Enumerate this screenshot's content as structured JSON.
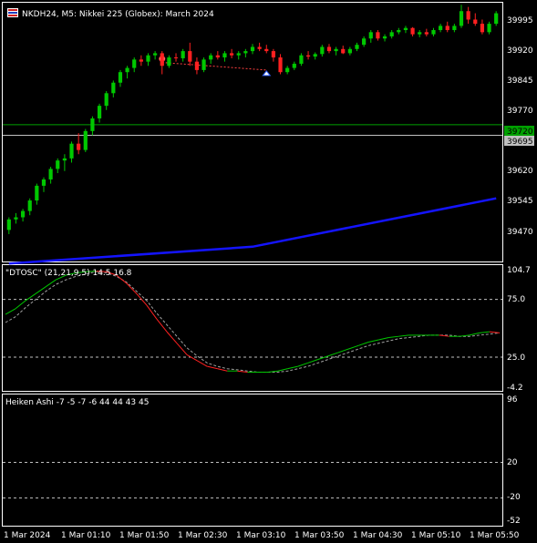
{
  "main_title": "NKDH24, M5:  Nikkei 225 (Globex): March 2024",
  "main_axis_labels": [
    "39995",
    "39920",
    "39845",
    "39770",
    "39620",
    "39545",
    "39470"
  ],
  "level_labels": [
    "39720",
    "39695"
  ],
  "osc_title": "\"DTOSC\" (21,21,9,5) 14.5 16.8",
  "osc_axis_labels": [
    "104.7",
    "75.0",
    "25.0",
    "-4.2"
  ],
  "ha_title": "Heiken Ashi -7 -5 -7 -6 44 44 43 45",
  "ha_axis_labels": [
    "96",
    "20",
    "-20",
    "-52"
  ],
  "time_labels": [
    "1 Mar 2024",
    "1 Mar 01:10",
    "1 Mar 01:50",
    "1 Mar 02:30",
    "1 Mar 03:10",
    "1 Mar 03:50",
    "1 Mar 04:30",
    "1 Mar 05:10",
    "1 Mar 05:50"
  ],
  "colors": {
    "background": "#000000",
    "bull": "#00c800",
    "bear": "#ff2020",
    "ma": "#1414ff",
    "level": "#00a000",
    "grid": "#c0c0c0"
  },
  "chart_data": {
    "type": "candlestick",
    "candles": [
      [
        39470,
        39500,
        39460,
        39495
      ],
      [
        39495,
        39510,
        39485,
        39500
      ],
      [
        39500,
        39520,
        39490,
        39515
      ],
      [
        39515,
        39545,
        39505,
        39540
      ],
      [
        39540,
        39580,
        39530,
        39575
      ],
      [
        39575,
        39595,
        39560,
        39590
      ],
      [
        39590,
        39620,
        39580,
        39615
      ],
      [
        39615,
        39640,
        39605,
        39635
      ],
      [
        39635,
        39650,
        39610,
        39640
      ],
      [
        39640,
        39680,
        39630,
        39675
      ],
      [
        39675,
        39700,
        39650,
        39660
      ],
      [
        39660,
        39710,
        39655,
        39705
      ],
      [
        39705,
        39740,
        39695,
        39735
      ],
      [
        39735,
        39770,
        39725,
        39765
      ],
      [
        39765,
        39800,
        39755,
        39795
      ],
      [
        39795,
        39825,
        39785,
        39820
      ],
      [
        39820,
        39850,
        39810,
        39845
      ],
      [
        39845,
        39860,
        39830,
        39855
      ],
      [
        39855,
        39880,
        39845,
        39875
      ],
      [
        39875,
        39885,
        39860,
        39870
      ],
      [
        39870,
        39890,
        39860,
        39885
      ],
      [
        39885,
        39895,
        39875,
        39890
      ],
      [
        39890,
        39895,
        39840,
        39860
      ],
      [
        39860,
        39885,
        39855,
        39880
      ],
      [
        39880,
        39890,
        39870,
        39878
      ],
      [
        39878,
        39900,
        39870,
        39895
      ],
      [
        39895,
        39915,
        39860,
        39870
      ],
      [
        39870,
        39880,
        39840,
        39850
      ],
      [
        39850,
        39880,
        39845,
        39875
      ],
      [
        39875,
        39890,
        39865,
        39885
      ],
      [
        39885,
        39895,
        39875,
        39880
      ],
      [
        39880,
        39895,
        39870,
        39890
      ],
      [
        39890,
        39900,
        39878,
        39885
      ],
      [
        39885,
        39895,
        39875,
        39890
      ],
      [
        39890,
        39900,
        39880,
        39895
      ],
      [
        39895,
        39912,
        39888,
        39905
      ],
      [
        39905,
        39915,
        39895,
        39900
      ],
      [
        39900,
        39910,
        39890,
        39895
      ],
      [
        39895,
        39900,
        39870,
        39880
      ],
      [
        39880,
        39888,
        39840,
        39845
      ],
      [
        39845,
        39860,
        39840,
        39855
      ],
      [
        39855,
        39870,
        39850,
        39865
      ],
      [
        39865,
        39890,
        39860,
        39885
      ],
      [
        39885,
        39895,
        39875,
        39882
      ],
      [
        39882,
        39892,
        39875,
        39888
      ],
      [
        39888,
        39910,
        39882,
        39905
      ],
      [
        39905,
        39912,
        39890,
        39895
      ],
      [
        39895,
        39905,
        39885,
        39900
      ],
      [
        39900,
        39908,
        39888,
        39890
      ],
      [
        39890,
        39905,
        39885,
        39900
      ],
      [
        39900,
        39915,
        39895,
        39910
      ],
      [
        39910,
        39930,
        39905,
        39925
      ],
      [
        39925,
        39945,
        39915,
        39940
      ],
      [
        39940,
        39945,
        39920,
        39925
      ],
      [
        39925,
        39935,
        39918,
        39930
      ],
      [
        39930,
        39945,
        39925,
        39940
      ],
      [
        39940,
        39950,
        39935,
        39945
      ],
      [
        39945,
        39955,
        39938,
        39950
      ],
      [
        39950,
        39952,
        39930,
        39935
      ],
      [
        39935,
        39945,
        39928,
        39940
      ],
      [
        39940,
        39948,
        39930,
        39935
      ],
      [
        39935,
        39950,
        39930,
        39945
      ],
      [
        39945,
        39960,
        39940,
        39955
      ],
      [
        39955,
        39965,
        39940,
        39945
      ],
      [
        39945,
        39960,
        39940,
        39955
      ],
      [
        39955,
        40005,
        39950,
        39990
      ],
      [
        39990,
        40000,
        39960,
        39970
      ],
      [
        39970,
        39985,
        39955,
        39960
      ],
      [
        39960,
        39970,
        39935,
        39940
      ],
      [
        39940,
        39965,
        39935,
        39960
      ],
      [
        39960,
        39990,
        39955,
        39985
      ]
    ],
    "ma_line": [
      [
        0,
        39390
      ],
      [
        35,
        39430
      ],
      [
        70,
        39545
      ]
    ],
    "arrow_line": [
      [
        22,
        39868
      ],
      [
        37,
        39850
      ]
    ],
    "levels": [
      39720,
      39695
    ],
    "osc": {
      "main": [
        62,
        67,
        74,
        80,
        86,
        92,
        96,
        98,
        99,
        99.5,
        99,
        96,
        89,
        80,
        70,
        58,
        47,
        37,
        27,
        22,
        17,
        15,
        13,
        13,
        12,
        12,
        12,
        13,
        15,
        17,
        20,
        23,
        26,
        29,
        32,
        35,
        38,
        40,
        42,
        43,
        44,
        44,
        44,
        44,
        43,
        43,
        44,
        46,
        47,
        46
      ],
      "signal": [
        55,
        60,
        68,
        75,
        82,
        88,
        92,
        95,
        97,
        99,
        98,
        95,
        90,
        82,
        74,
        63,
        53,
        43,
        33,
        26,
        20,
        17,
        15,
        14,
        13,
        12,
        12,
        12,
        13,
        15,
        17,
        20,
        23,
        26,
        29,
        32,
        35,
        37,
        39,
        41,
        42,
        43,
        44,
        44,
        44,
        43,
        43,
        44,
        45,
        46
      ],
      "ylim": [
        -4.2,
        104.7
      ],
      "levels": [
        75,
        25
      ]
    },
    "ha": {
      "ylim": [
        -52,
        96
      ],
      "levels": [
        20,
        -20
      ]
    },
    "ylim": [
      39395,
      40010
    ]
  }
}
